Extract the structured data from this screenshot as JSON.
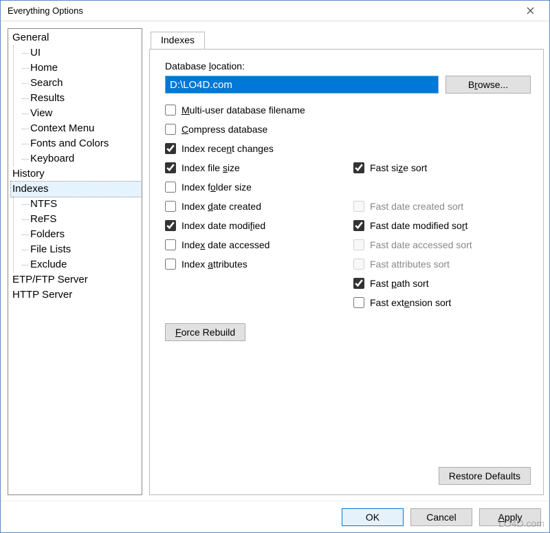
{
  "window": {
    "title": "Everything Options"
  },
  "tree": {
    "general": "General",
    "general_children": [
      "UI",
      "Home",
      "Search",
      "Results",
      "View",
      "Context Menu",
      "Fonts and Colors",
      "Keyboard"
    ],
    "history": "History",
    "indexes": "Indexes",
    "indexes_children": [
      "NTFS",
      "ReFS",
      "Folders",
      "File Lists",
      "Exclude"
    ],
    "etp": "ETP/FTP Server",
    "http": "HTTP Server",
    "selected": "Indexes"
  },
  "tab": {
    "label": "Indexes"
  },
  "db": {
    "label_pre": "Database ",
    "label_ukey": "l",
    "label_post": "ocation:",
    "value": "D:\\LO4D.com",
    "browse_pre": "B",
    "browse_ukey": "r",
    "browse_post": "owse..."
  },
  "checks": {
    "multi_user": {
      "pre": "",
      "u": "M",
      "post": "ulti-user database filename",
      "checked": false,
      "disabled": false
    },
    "compress": {
      "pre": "",
      "u": "C",
      "post": "ompress database",
      "checked": false,
      "disabled": false
    },
    "recent": {
      "pre": "Index rece",
      "u": "n",
      "post": "t changes",
      "checked": true,
      "disabled": false
    },
    "size": {
      "pre": "Index file ",
      "u": "s",
      "post": "ize",
      "checked": true,
      "disabled": false
    },
    "fast_size": {
      "pre": "Fast si",
      "u": "z",
      "post": "e sort",
      "checked": true,
      "disabled": false
    },
    "folder": {
      "pre": "Index f",
      "u": "o",
      "post": "lder size",
      "checked": false,
      "disabled": false
    },
    "created": {
      "pre": "Index ",
      "u": "d",
      "post": "ate created",
      "checked": false,
      "disabled": false
    },
    "fast_created": {
      "pre": "Fast date created sort",
      "u": "",
      "post": "",
      "checked": false,
      "disabled": true
    },
    "modified": {
      "pre": "Index date modi",
      "u": "f",
      "post": "ied",
      "checked": true,
      "disabled": false
    },
    "fast_modified": {
      "pre": "Fast date modified so",
      "u": "r",
      "post": "t",
      "checked": true,
      "disabled": false
    },
    "accessed": {
      "pre": "Inde",
      "u": "x",
      "post": " date accessed",
      "checked": false,
      "disabled": false
    },
    "fast_accessed": {
      "pre": "Fast date accessed sort",
      "u": "",
      "post": "",
      "checked": false,
      "disabled": true
    },
    "attributes": {
      "pre": "Index ",
      "u": "a",
      "post": "ttributes",
      "checked": false,
      "disabled": false
    },
    "fast_attributes": {
      "pre": "Fast attributes sort",
      "u": "",
      "post": "",
      "checked": false,
      "disabled": true
    },
    "fast_path": {
      "pre": "Fast ",
      "u": "p",
      "post": "ath sort",
      "checked": true,
      "disabled": false
    },
    "fast_ext": {
      "pre": "Fast ext",
      "u": "e",
      "post": "nsion sort",
      "checked": false,
      "disabled": false
    }
  },
  "buttons": {
    "force_pre": "",
    "force_u": "F",
    "force_post": "orce Rebuild",
    "restore": "Restore Defaults",
    "ok": "OK",
    "cancel": "Cancel",
    "apply_pre": "",
    "apply_u": "A",
    "apply_post": "pply"
  },
  "watermark": "LO4D.com"
}
